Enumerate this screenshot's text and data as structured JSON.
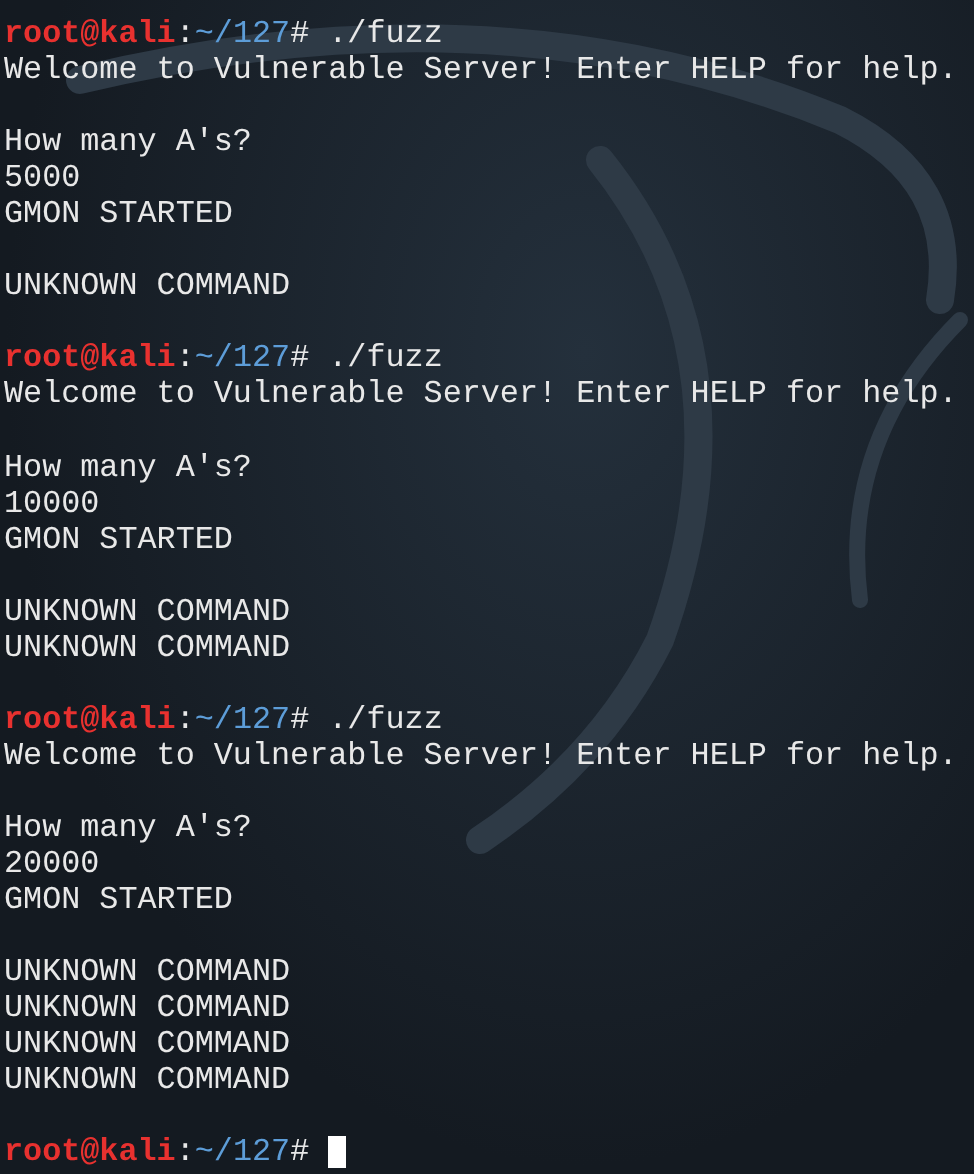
{
  "terminal": {
    "lines": [
      {
        "kind": "prompt",
        "user_host": "root@kali",
        "separator": ":",
        "path": "~/127",
        "symbol": "#",
        "command": "./fuzz"
      },
      {
        "kind": "output",
        "text": "Welcome to Vulnerable Server! Enter HELP for help."
      },
      {
        "kind": "blank"
      },
      {
        "kind": "output",
        "text": "How many A's?"
      },
      {
        "kind": "output",
        "text": "5000"
      },
      {
        "kind": "output",
        "text": "GMON STARTED"
      },
      {
        "kind": "blank"
      },
      {
        "kind": "output",
        "text": "UNKNOWN COMMAND"
      },
      {
        "kind": "blank"
      },
      {
        "kind": "prompt",
        "user_host": "root@kali",
        "separator": ":",
        "path": "~/127",
        "symbol": "#",
        "command": "./fuzz"
      },
      {
        "kind": "output",
        "text": "Welcome to Vulnerable Server! Enter HELP for help."
      },
      {
        "kind": "blank"
      },
      {
        "kind": "output",
        "text": "How many A's?"
      },
      {
        "kind": "output",
        "text": "10000"
      },
      {
        "kind": "output",
        "text": "GMON STARTED"
      },
      {
        "kind": "blank"
      },
      {
        "kind": "output",
        "text": "UNKNOWN COMMAND"
      },
      {
        "kind": "output",
        "text": "UNKNOWN COMMAND"
      },
      {
        "kind": "blank"
      },
      {
        "kind": "prompt",
        "user_host": "root@kali",
        "separator": ":",
        "path": "~/127",
        "symbol": "#",
        "command": "./fuzz"
      },
      {
        "kind": "output",
        "text": "Welcome to Vulnerable Server! Enter HELP for help."
      },
      {
        "kind": "blank"
      },
      {
        "kind": "output",
        "text": "How many A's?"
      },
      {
        "kind": "output",
        "text": "20000"
      },
      {
        "kind": "output",
        "text": "GMON STARTED"
      },
      {
        "kind": "blank"
      },
      {
        "kind": "output",
        "text": "UNKNOWN COMMAND"
      },
      {
        "kind": "output",
        "text": "UNKNOWN COMMAND"
      },
      {
        "kind": "output",
        "text": "UNKNOWN COMMAND"
      },
      {
        "kind": "output",
        "text": "UNKNOWN COMMAND"
      },
      {
        "kind": "blank"
      },
      {
        "kind": "prompt",
        "user_host": "root@kali",
        "separator": ":",
        "path": "~/127",
        "symbol": "#",
        "cursor": true
      }
    ]
  }
}
